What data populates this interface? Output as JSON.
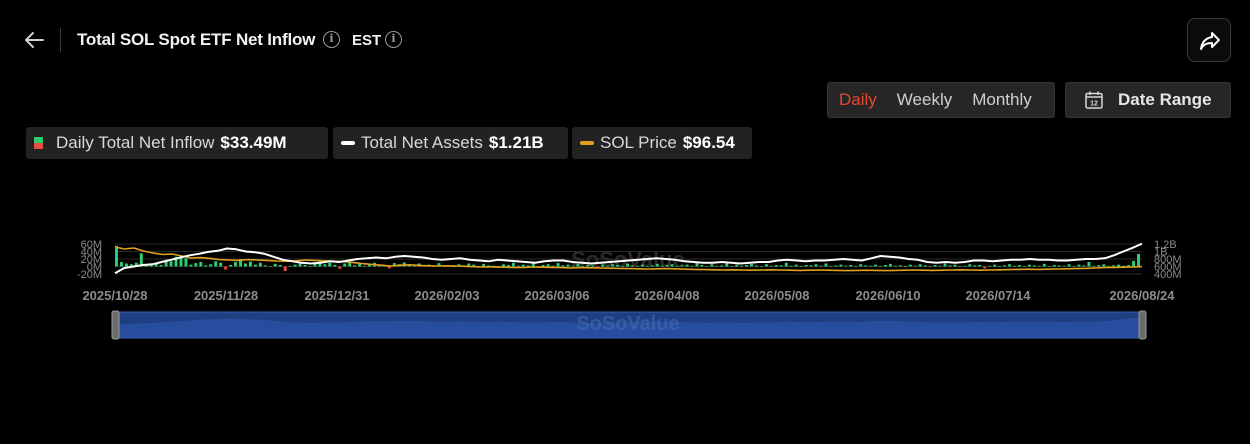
{
  "header": {
    "title": "Total SOL Spot ETF Net Inflow",
    "timezone": "EST"
  },
  "controls": {
    "periods": [
      {
        "label": "Daily",
        "active": true
      },
      {
        "label": "Weekly",
        "active": false
      },
      {
        "label": "Monthly",
        "active": false
      }
    ],
    "date_range_label": "Date Range",
    "date_range_icon_number": "12"
  },
  "legend": [
    {
      "label": "Daily Total Net Inflow",
      "value": "$33.49M",
      "icon": "bar-swatch"
    },
    {
      "label": "Total Net Assets",
      "value": "$1.21B",
      "color": "#ffffff"
    },
    {
      "label": "SOL Price",
      "value": "$96.54",
      "color": "#e0a020"
    }
  ],
  "colors": {
    "inflow_positive": "#2ecc71",
    "inflow_negative": "#e74c3c",
    "net_assets": "#ffffff",
    "sol_price": "#e0a020",
    "active_period": "#e8472f",
    "navigator_fill": "#1f3f82"
  },
  "watermark": "SoSoValue",
  "chart_data": {
    "type": "bar",
    "x_ticks": [
      "2025/10/28",
      "2025/11/28",
      "2025/12/31",
      "2026/02/03",
      "2026/03/06",
      "2026/04/08",
      "2026/05/08",
      "2026/06/10",
      "2026/07/14",
      "2026/08/24"
    ],
    "y_left_ticks": [
      "60M",
      "40M",
      "20M",
      "0M",
      "-20M"
    ],
    "y_left_range": [
      -20,
      60
    ],
    "y_right_ticks": [
      "1.2B",
      "1B",
      "800M",
      "600M",
      "400M"
    ],
    "y_right_range": [
      400,
      1200
    ],
    "series": [
      {
        "name": "Daily Total Net Inflow",
        "type": "bar",
        "values": [
          55,
          12,
          8,
          6,
          10,
          35,
          3,
          5,
          9,
          4,
          18,
          14,
          26,
          30,
          22,
          5,
          9,
          12,
          3,
          6,
          14,
          10,
          -8,
          4,
          12,
          20,
          8,
          13,
          5,
          10,
          3,
          0,
          7,
          4,
          -12,
          2,
          5,
          9,
          4,
          1,
          8,
          15,
          6,
          10,
          4,
          -6,
          8,
          12,
          3,
          7,
          2,
          6,
          10,
          5,
          3,
          -5,
          9,
          6,
          11,
          4,
          2,
          8,
          3,
          5,
          1,
          9,
          4,
          2,
          0,
          6,
          3,
          8,
          5,
          1,
          7,
          3,
          2,
          -4,
          6,
          4,
          10,
          2,
          5,
          3,
          8,
          1,
          4,
          6,
          2,
          9,
          3,
          5,
          2,
          7,
          1,
          4,
          3,
          -3,
          5,
          2,
          6,
          4,
          1,
          8,
          3,
          2,
          5,
          1,
          3,
          7,
          2,
          4,
          6,
          1,
          3,
          5,
          2,
          9,
          4,
          1,
          6,
          2,
          3,
          8,
          1,
          5,
          2,
          4,
          7,
          3,
          1,
          6,
          2,
          4,
          3,
          10,
          2,
          5,
          1,
          4,
          3,
          6,
          2,
          8,
          1,
          3,
          5,
          2,
          4,
          1,
          6,
          3,
          2,
          5,
          1,
          4,
          7,
          2,
          3,
          1,
          5,
          2,
          6,
          3,
          1,
          4,
          2,
          8,
          3,
          5,
          1,
          2,
          6,
          3,
          4,
          -5,
          2,
          5,
          1,
          3,
          6,
          2,
          4,
          1,
          5,
          3,
          2,
          7,
          1,
          4,
          3,
          2,
          6,
          1,
          5,
          3,
          12,
          2,
          4,
          6,
          1,
          3,
          5,
          2,
          4,
          15,
          33.49
        ]
      },
      {
        "name": "Total Net Assets",
        "type": "line",
        "values": [
          420,
          560,
          600,
          640,
          660,
          720,
          780,
          840,
          900,
          940,
          990,
          1020,
          1080,
          1060,
          1000,
          980,
          940,
          860,
          780,
          740,
          700,
          680,
          700,
          740,
          720,
          760,
          800,
          820,
          840,
          820,
          860,
          880,
          860,
          840,
          800,
          780,
          800,
          820,
          780,
          760,
          740,
          780,
          760,
          740,
          720,
          700,
          740,
          760,
          760,
          720,
          700,
          680,
          700,
          720,
          740,
          760,
          780,
          800,
          820,
          800,
          780,
          740,
          720,
          700,
          700,
          720,
          700,
          680,
          700,
          720,
          720,
          760,
          780,
          760,
          740,
          760,
          760,
          780,
          800,
          780,
          760,
          820,
          880,
          860,
          840,
          800,
          780,
          720,
          700,
          720,
          700,
          720,
          760,
          760,
          740,
          760,
          780,
          780,
          800,
          780,
          780,
          760,
          760,
          780,
          800,
          800,
          820,
          900,
          1000,
          1100,
          1210
        ]
      },
      {
        "name": "SOL Price",
        "type": "line",
        "values": [
          195,
          185,
          190,
          175,
          165,
          158,
          160,
          150,
          140,
          142,
          138,
          132,
          130,
          128,
          132,
          130,
          128,
          125,
          124,
          126,
          130,
          128,
          126,
          124,
          122,
          118,
          112,
          108,
          104,
          100,
          104,
          106,
          103,
          101,
          100,
          101,
          100,
          98,
          96,
          95,
          96,
          94,
          92,
          93,
          95,
          94,
          93,
          92,
          90,
          92,
          91,
          90,
          89,
          88,
          87,
          86,
          85,
          86,
          87,
          86,
          84,
          83,
          82,
          81,
          80,
          81,
          80,
          79,
          80,
          81,
          80,
          79,
          78,
          79,
          80,
          79,
          78,
          77,
          78,
          79,
          78,
          77,
          78,
          79,
          80,
          79,
          78,
          79,
          80,
          81,
          80,
          79,
          80,
          81,
          82,
          83,
          84,
          83,
          84,
          85,
          86,
          87,
          88,
          90,
          92,
          93,
          94,
          95,
          96.54
        ]
      }
    ]
  }
}
